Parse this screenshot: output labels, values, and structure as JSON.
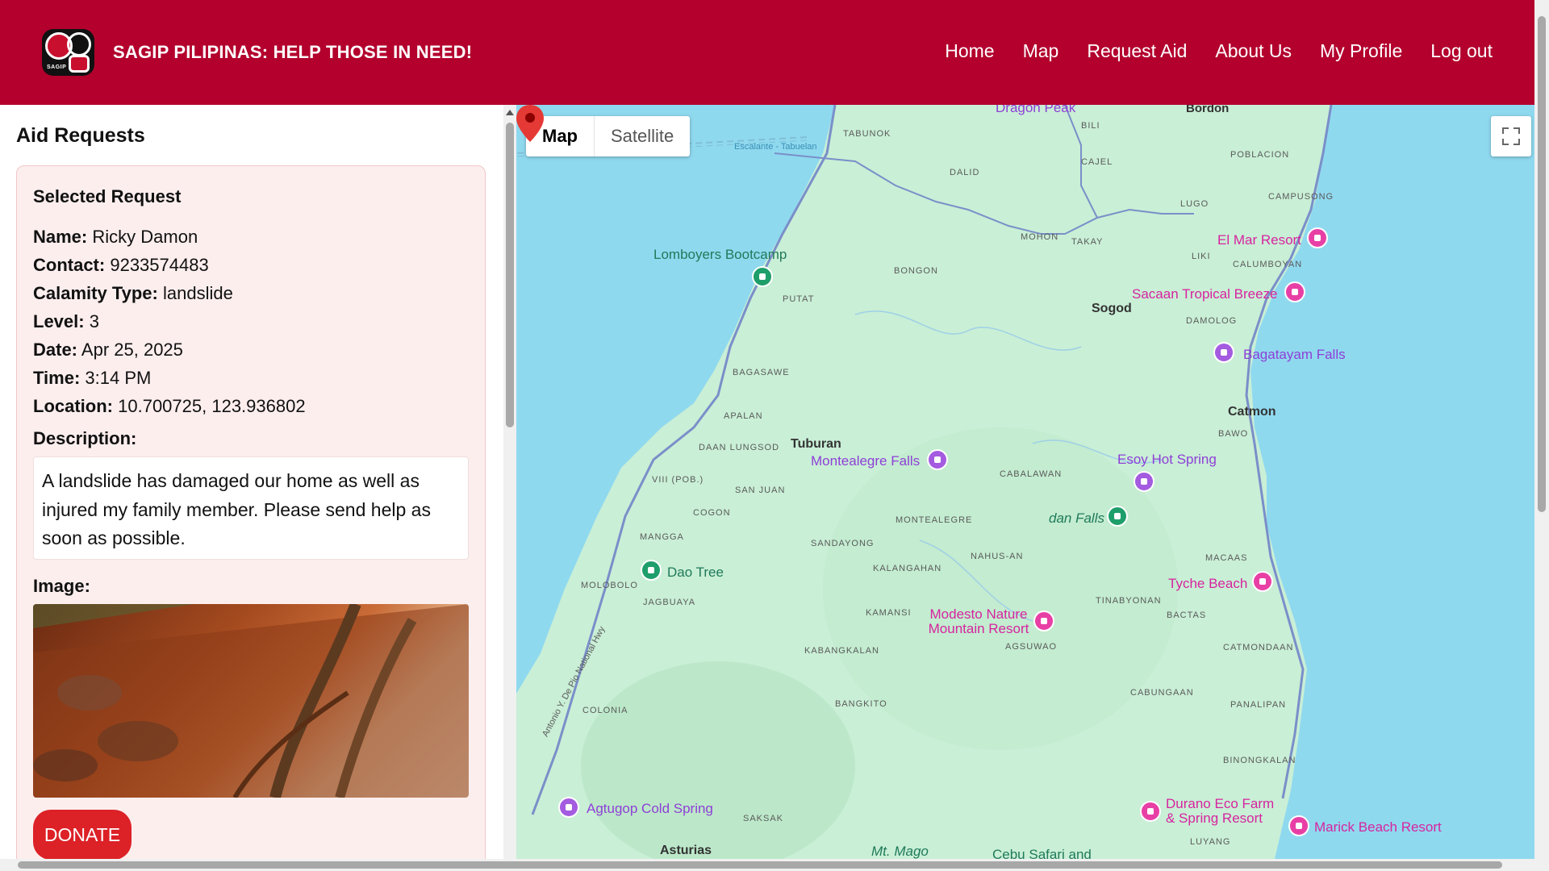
{
  "header": {
    "brand": "SAGIP PILIPINAS: HELP THOSE IN NEED!",
    "logo_text": "SAGIP",
    "nav": [
      "Home",
      "Map",
      "Request Aid",
      "About Us",
      "My Profile",
      "Log out"
    ],
    "color": "#b3002d"
  },
  "sidebar": {
    "title": "Aid Requests",
    "card": {
      "heading": "Selected Request",
      "fields": [
        {
          "label": "Name:",
          "value": "Ricky Damon"
        },
        {
          "label": "Contact:",
          "value": "9233574483"
        },
        {
          "label": "Calamity Type:",
          "value": "landslide"
        },
        {
          "label": "Level:",
          "value": "3"
        },
        {
          "label": "Date:",
          "value": "Apr 25, 2025"
        },
        {
          "label": "Time:",
          "value": "3:14 PM"
        },
        {
          "label": "Location:",
          "value": "10.700725, 123.936802"
        }
      ],
      "description_label": "Description:",
      "description": "A landslide has damaged our home as well as injured my family member. Please send help as soon as possible.",
      "image_label": "Image:",
      "donate_label": "DONATE"
    }
  },
  "map": {
    "type_active": "Map",
    "type_inactive": "Satellite",
    "cities": [
      "Sogod",
      "Tuburan",
      "Catmon",
      "Asturias"
    ],
    "barangays": [
      "TABUNOK",
      "BILI",
      "CAJEL",
      "DALID",
      "POBLACION",
      "CAMPUSONG",
      "LUGO",
      "MOHON",
      "TAKAY",
      "LIKI",
      "CALUMBOYAN",
      "PUTAT",
      "BONGON",
      "DAMOLOG",
      "BAGASAWE",
      "APALAN",
      "DAAN LUNGSOD",
      "VIII (POB.)",
      "SAN JUAN",
      "COGON",
      "CABALAWAN",
      "BAWO",
      "MONTEALEGRE",
      "SANDAYONG",
      "NAHUS-AN",
      "MANGGA",
      "MOLOBOLO",
      "JAGBUAYA",
      "KALANGAHAN",
      "KAMANSI",
      "AGSUWAO",
      "TINABYONAN",
      "BACTAS",
      "MACAAS",
      "CATMONDAAN",
      "KABANGKALAN",
      "BANGKITO",
      "CABUNGAAN",
      "PANALIPAN",
      "COLONIA",
      "BINONGKALAN",
      "SAKSAK",
      "LUYANG",
      "Bordon",
      "Escalante - Tabuelan",
      "Antonio Y. De Pio National Hwy"
    ],
    "pois": [
      {
        "name": "Dragon Peak",
        "kind": "purple"
      },
      {
        "name": "Lomboyers Bootcamp",
        "kind": "green"
      },
      {
        "name": "El Mar Resort",
        "kind": "pink"
      },
      {
        "name": "Sacaan Tropical Breeze",
        "kind": "pink"
      },
      {
        "name": "Bagatayam Falls",
        "kind": "purple"
      },
      {
        "name": "Montealegre Falls",
        "kind": "purple"
      },
      {
        "name": "Esoy Hot Spring",
        "kind": "purple"
      },
      {
        "name": "dan Falls",
        "kind": "green"
      },
      {
        "name": "Dao Tree",
        "kind": "green"
      },
      {
        "name": "Tyche Beach",
        "kind": "pink"
      },
      {
        "name": "Modesto Nature Mountain Resort",
        "kind": "pink"
      },
      {
        "name": "Agtugop Cold Spring",
        "kind": "purple"
      },
      {
        "name": "Durano Eco Farm & Spring Resort",
        "kind": "pink"
      },
      {
        "name": "Marick Beach Resort",
        "kind": "pink"
      },
      {
        "name": "Mt. Mago",
        "kind": "green"
      },
      {
        "name": "Cebu Safari and",
        "kind": "green"
      }
    ],
    "colors": {
      "water": "#8fd9ef",
      "land": "#c9efd6",
      "road": "#7a8fc9",
      "marker": "#e53935"
    }
  }
}
